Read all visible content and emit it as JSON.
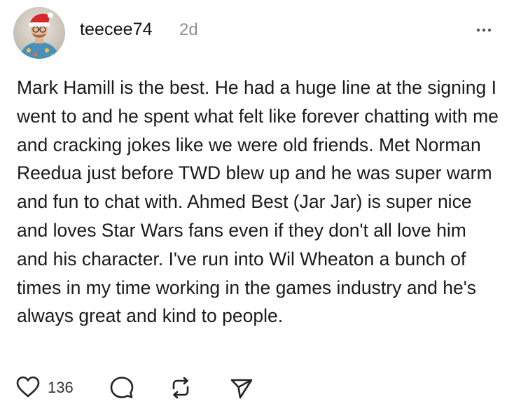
{
  "post": {
    "author": "teecee74",
    "time_ago": "2d",
    "text": "Mark Hamill is the best. He had a huge line at the signing I went to and he spent what felt like forever chatting with me and cracking jokes like we were old friends. Met Norman Reedua just before TWD blew up and he was super warm and fun to chat with. Ahmed Best (Jar Jar) is super nice and loves Star Wars fans even if they don't all love him and his character. I've run into Wil Wheaton a bunch of times in my time working in the games industry and he's always great and kind to people.",
    "likes": "136"
  },
  "icons": {
    "avatar": "avatar-photo",
    "more": "more-options-icon",
    "like": "heart-icon",
    "comment": "comment-bubble-icon",
    "repost": "repost-icon",
    "share": "send-icon"
  },
  "colors": {
    "text": "#1a1a1a",
    "muted": "#8e8e8e",
    "background": "#ffffff"
  }
}
